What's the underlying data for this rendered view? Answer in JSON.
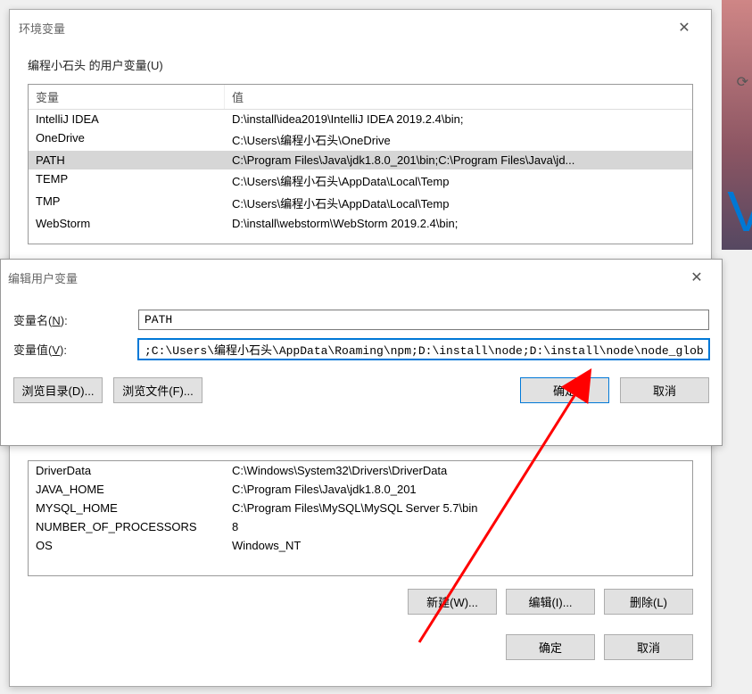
{
  "mainWindow": {
    "title": "环境变量",
    "userSectionLabel": "编程小石头 的用户变量(U)",
    "columns": {
      "var": "变量",
      "val": "值"
    },
    "userVars": [
      {
        "name": "IntelliJ IDEA",
        "value": "D:\\install\\idea2019\\IntelliJ IDEA 2019.2.4\\bin;"
      },
      {
        "name": "OneDrive",
        "value": "C:\\Users\\编程小石头\\OneDrive"
      },
      {
        "name": "PATH",
        "value": "C:\\Program Files\\Java\\jdk1.8.0_201\\bin;C:\\Program Files\\Java\\jd...",
        "selected": true
      },
      {
        "name": "TEMP",
        "value": "C:\\Users\\编程小石头\\AppData\\Local\\Temp"
      },
      {
        "name": "TMP",
        "value": "C:\\Users\\编程小石头\\AppData\\Local\\Temp"
      },
      {
        "name": "WebStorm",
        "value": "D:\\install\\webstorm\\WebStorm 2019.2.4\\bin;"
      }
    ],
    "sysVars": [
      {
        "name": "DriverData",
        "value": "C:\\Windows\\System32\\Drivers\\DriverData"
      },
      {
        "name": "JAVA_HOME",
        "value": "C:\\Program Files\\Java\\jdk1.8.0_201"
      },
      {
        "name": "MYSQL_HOME",
        "value": "C:\\Program Files\\MySQL\\MySQL Server 5.7\\bin"
      },
      {
        "name": "NUMBER_OF_PROCESSORS",
        "value": "8"
      },
      {
        "name": "OS",
        "value": "Windows_NT"
      }
    ],
    "buttons": {
      "new": "新建(W)...",
      "edit": "编辑(I)...",
      "delete": "删除(L)",
      "ok": "确定",
      "cancel": "取消"
    }
  },
  "editDialog": {
    "title": "编辑用户变量",
    "nameLabel": "变量名(N):",
    "valueLabel": "变量值(V):",
    "nameValue": "PATH",
    "valueValue": ";C:\\Users\\编程小石头\\AppData\\Roaming\\npm;D:\\install\\node;D:\\install\\node\\node_global",
    "browseDir": "浏览目录(D)...",
    "browseFile": "浏览文件(F)...",
    "ok": "确定",
    "cancel": "取消"
  },
  "sideText": "Vi"
}
